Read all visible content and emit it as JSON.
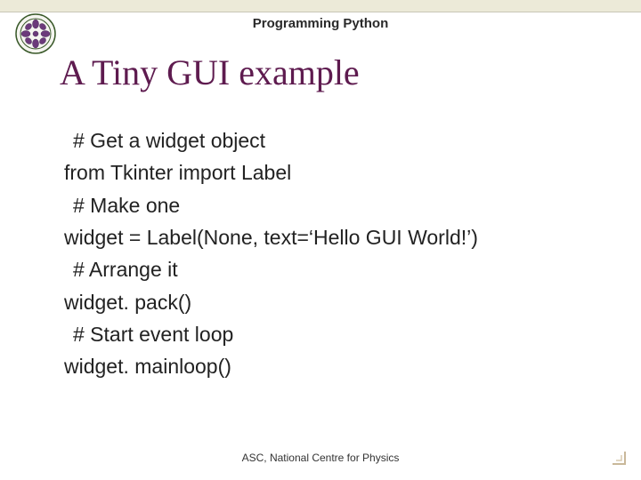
{
  "header": {
    "title": "Programming Python"
  },
  "slide": {
    "title": "A Tiny GUI example"
  },
  "code": {
    "line1": "# Get a widget object",
    "line2": "from Tkinter import Label",
    "line3": "# Make one",
    "line4": "widget = Label(None, text=‘Hello GUI World!’)",
    "line5": "# Arrange it",
    "line6": "widget. pack()",
    "line7": "# Start event loop",
    "line8": "widget. mainloop()"
  },
  "footer": {
    "text": "ASC, National Centre for Physics"
  },
  "colors": {
    "title": "#5e1b4f",
    "topbar": "#ecead8"
  }
}
